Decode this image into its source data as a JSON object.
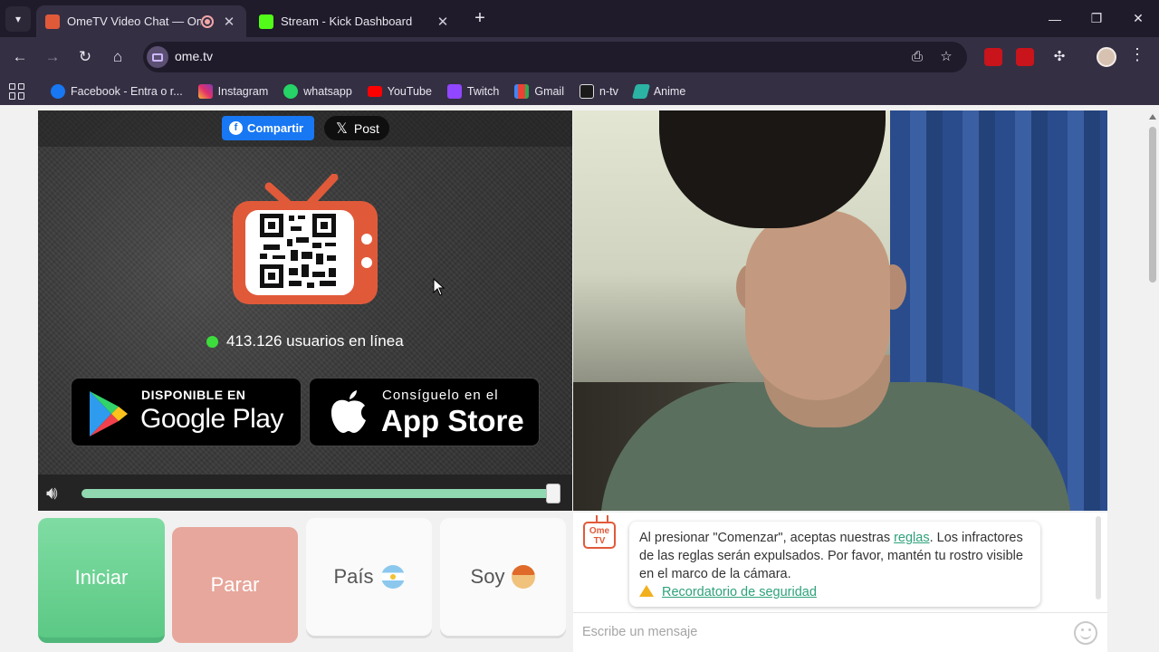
{
  "browser": {
    "tabs": [
      {
        "title": "OmeTV Video Chat — Ome",
        "active": true
      },
      {
        "title": "Stream - Kick Dashboard",
        "active": false
      }
    ],
    "url": "ome.tv",
    "bookmarks": [
      {
        "label": "Facebook - Entra o r...",
        "icon": "facebook-icon",
        "color": "#1877f2"
      },
      {
        "label": "Instagram",
        "icon": "instagram-icon",
        "color": "#e1306c"
      },
      {
        "label": "whatsapp",
        "icon": "whatsapp-icon",
        "color": "#25d366"
      },
      {
        "label": "YouTube",
        "icon": "youtube-icon",
        "color": "#ff0000"
      },
      {
        "label": "Twitch",
        "icon": "twitch-icon",
        "color": "#9146ff"
      },
      {
        "label": "Gmail",
        "icon": "gmail-icon",
        "color": "#ea4335"
      },
      {
        "label": "n-tv",
        "icon": "ntv-icon",
        "color": "#1b1b1b"
      },
      {
        "label": "Anime",
        "icon": "anime-icon",
        "color": "#2bb3a3"
      }
    ]
  },
  "video_left": {
    "share_label": "Compartir",
    "post_label": "Post",
    "online_text": "413.126 usuarios en línea",
    "google_play": {
      "small": "DISPONIBLE EN",
      "big": "Google Play"
    },
    "app_store": {
      "small": "Consíguelo en el",
      "big": "App Store"
    },
    "volume_percent": 100
  },
  "controls": {
    "start_label": "Iniciar",
    "stop_label": "Parar",
    "country_label": "País",
    "gender_label": "Soy"
  },
  "chat": {
    "logo_text": "Ome TV",
    "message_part1": "Al presionar \"Comenzar\", aceptas nuestras ",
    "rules_link": "reglas",
    "message_part2": ". Los infractores de las reglas serán expulsados. Por favor, mantén tu rostro visible en el marco de la cámara.",
    "safety_link": "Recordatorio de seguridad",
    "input_placeholder": "Escribe un mensaje"
  },
  "colors": {
    "accent_green": "#5cc985",
    "stop_red": "#e7a79c",
    "link_green": "#2ea27a",
    "facebook_blue": "#1877f2"
  }
}
